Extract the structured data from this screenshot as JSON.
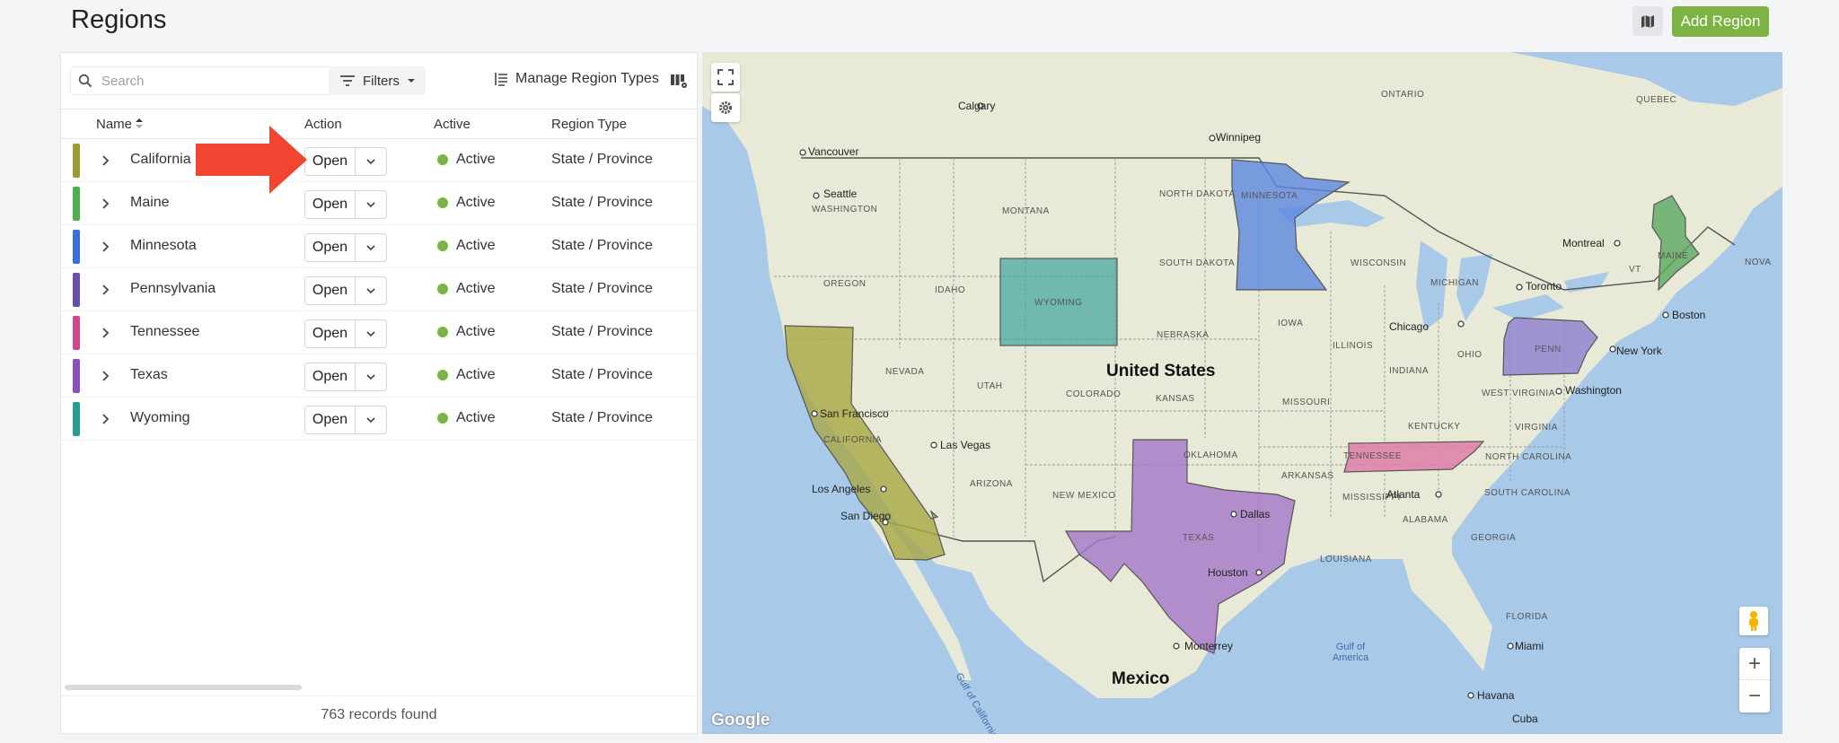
{
  "page": {
    "title": "Regions",
    "add_region_label": "Add Region"
  },
  "toolbar": {
    "search_placeholder": "Search",
    "filters_label": "Filters",
    "manage_label": "Manage Region Types"
  },
  "table": {
    "headers": {
      "name": "Name",
      "action": "Action",
      "active": "Active",
      "region_type": "Region Type"
    },
    "rows": [
      {
        "name": "California",
        "color": "#9b9a33",
        "action": "Open",
        "status": "Active",
        "type": "State / Province"
      },
      {
        "name": "Maine",
        "color": "#4caf50",
        "action": "Open",
        "status": "Active",
        "type": "State / Province"
      },
      {
        "name": "Minnesota",
        "color": "#3b6fe0",
        "action": "Open",
        "status": "Active",
        "type": "State / Province"
      },
      {
        "name": "Pennsylvania",
        "color": "#6a4fb0",
        "action": "Open",
        "status": "Active",
        "type": "State / Province"
      },
      {
        "name": "Tennessee",
        "color": "#d1478c",
        "action": "Open",
        "status": "Active",
        "type": "State / Province"
      },
      {
        "name": "Texas",
        "color": "#8c4fc0",
        "action": "Open",
        "status": "Active",
        "type": "State / Province"
      },
      {
        "name": "Wyoming",
        "color": "#2a9a93",
        "action": "Open",
        "status": "Active",
        "type": "State / Province"
      }
    ],
    "records_found": "763 records found"
  },
  "map": {
    "countries": {
      "usa": "United States",
      "mexico": "Mexico"
    },
    "regions": {
      "california": "CALIFORNIA",
      "wyoming": "WYOMING",
      "minnesota": "MINNESOTA",
      "maine": "MAINE",
      "penn": "PENN",
      "tennessee": "TENNESSEE",
      "texas": "TEXAS"
    },
    "states": [
      "ONTARIO",
      "QUEBEC",
      "WASHINGTON",
      "MONTANA",
      "NORTH DAKOTA",
      "SOUTH DAKOTA",
      "OREGON",
      "IDAHO",
      "NEBRASKA",
      "IOWA",
      "WISCONSIN",
      "MICHIGAN",
      "NEVADA",
      "UTAH",
      "COLORADO",
      "KANSAS",
      "MISSOURI",
      "ILLINOIS",
      "INDIANA",
      "OHIO",
      "WEST VIRGINIA",
      "VIRGINIA",
      "KENTUCKY",
      "NORTH CAROLINA",
      "SOUTH CAROLINA",
      "ARIZONA",
      "NEW MEXICO",
      "OKLAHOMA",
      "ARKANSAS",
      "MISSISSIPPI",
      "ALABAMA",
      "GEORGIA",
      "LOUISIANA",
      "FLORIDA",
      "VT",
      "NOVA"
    ],
    "cities": [
      "Calgary",
      "Winnipeg",
      "Vancouver",
      "Seattle",
      "Montreal",
      "Toronto",
      "Boston",
      "Chicago",
      "New York",
      "Washington",
      "San Francisco",
      "Las Vegas",
      "Los Angeles",
      "San Diego",
      "Atlanta",
      "Dallas",
      "Houston",
      "Monterrey",
      "Miami",
      "Havana",
      "Cuba"
    ],
    "water": {
      "gulf_california": "Gulf of California",
      "gulf_america": "Gulf of America"
    },
    "logo": "Google"
  },
  "colors": {
    "accent": "#7cb342",
    "active_dot": "#7cb342",
    "arrow": "#ef4531"
  }
}
